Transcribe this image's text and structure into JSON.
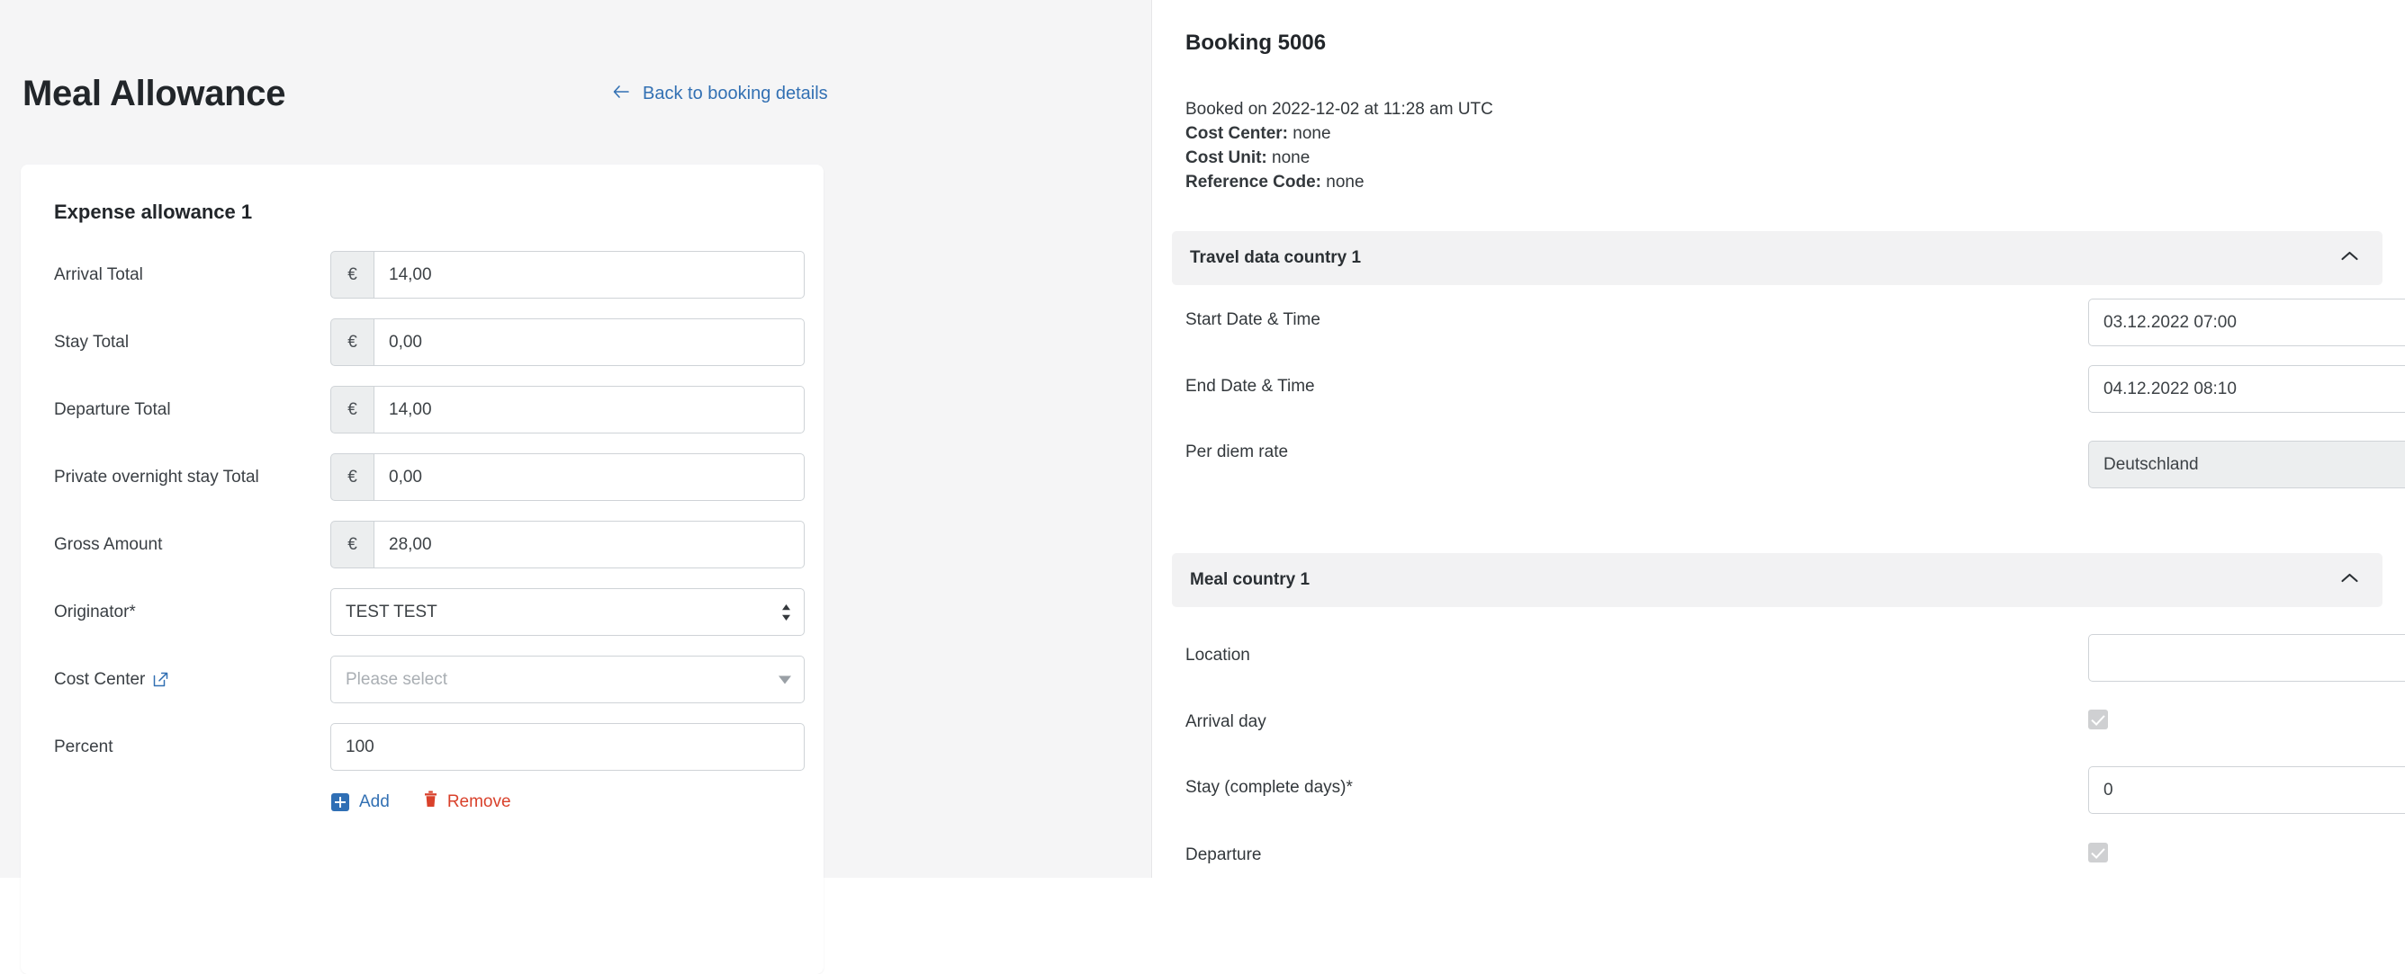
{
  "page": {
    "title": "Meal Allowance",
    "back_link": "Back to booking details",
    "back_icon": "arrow-left-icon"
  },
  "expense_card": {
    "title": "Expense allowance 1",
    "currency_symbol": "€",
    "fields": [
      {
        "label": "Arrival Total",
        "value": "14,00"
      },
      {
        "label": "Stay Total",
        "value": "0,00"
      },
      {
        "label": "Departure Total",
        "value": "14,00"
      },
      {
        "label": "Private overnight stay Total",
        "value": "0,00"
      },
      {
        "label": "Gross Amount",
        "value": "28,00"
      }
    ],
    "originator": {
      "label": "Originator*",
      "value": "TEST TEST",
      "icon": "select-updown-icon"
    },
    "cost_center": {
      "label": "Cost Center",
      "placeholder": "Please select",
      "value": "",
      "icon": "external-link-icon",
      "caret": "chevron-down-icon"
    },
    "percent": {
      "label": "Percent",
      "value": "100"
    },
    "actions": {
      "add": "Add",
      "remove": "Remove",
      "add_icon": "plus-square-icon",
      "remove_icon": "trash-icon"
    }
  },
  "booking": {
    "title": "Booking 5006",
    "booked_on": "Booked on 2022-12-02 at 11:28 am UTC",
    "cost_center_label": "Cost Center:",
    "cost_center_value": "none",
    "cost_unit_label": "Cost Unit:",
    "cost_unit_value": "none",
    "reference_code_label": "Reference Code:",
    "reference_code_value": "none"
  },
  "travel_section": {
    "title": "Travel data country 1",
    "collapse_icon": "chevron-up-icon",
    "start_label": "Start Date & Time",
    "start_value": "03.12.2022 07:00",
    "end_label": "End Date & Time",
    "end_value": "04.12.2022 08:10",
    "rate_label": "Per diem rate",
    "rate_value": "Deutschland",
    "rate_icon": "select-updown-icon"
  },
  "meal_section": {
    "title": "Meal country 1",
    "collapse_icon": "chevron-up-icon",
    "location_label": "Location",
    "location_value": "",
    "arrival_label": "Arrival day",
    "arrival_checked": true,
    "stay_label": "Stay (complete days)*",
    "stay_value": "0",
    "departure_label": "Departure",
    "departure_checked": true
  },
  "colors": {
    "link_blue": "#3270b3",
    "danger_red": "#d9412b",
    "page_bg": "#f5f5f6",
    "section_bg": "#f2f2f3",
    "border": "#cfd3d7"
  }
}
